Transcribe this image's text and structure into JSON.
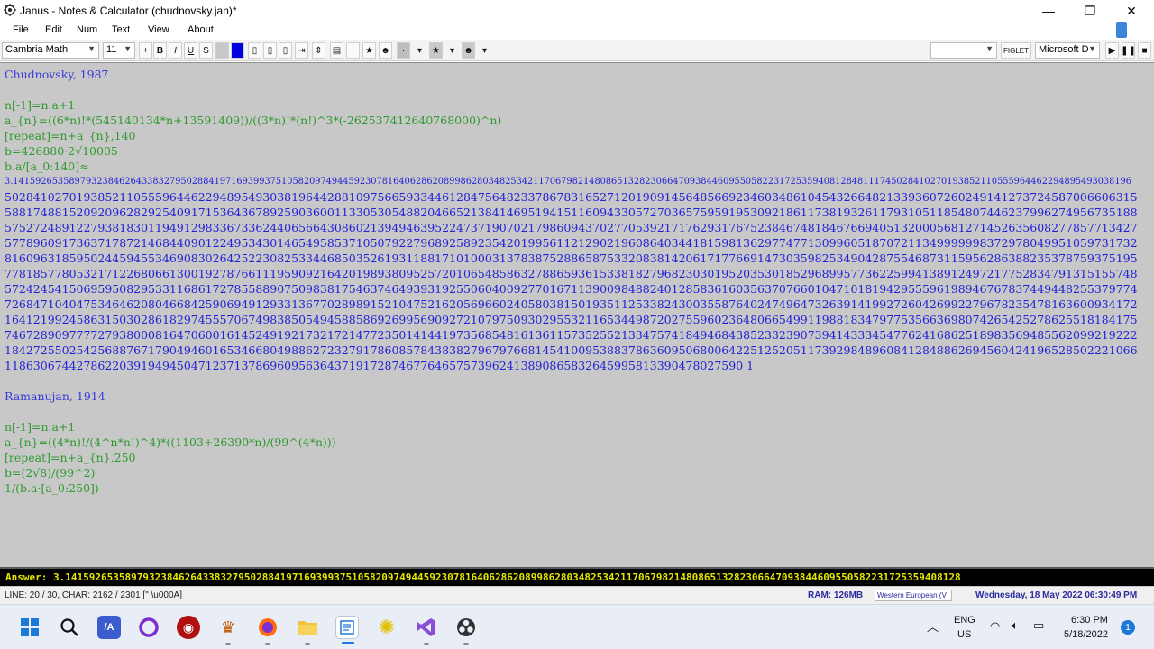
{
  "window": {
    "title": "Janus - Notes & Calculator (chudnovsky.jan)*",
    "icon": "gear-flower-icon",
    "minimize": "—",
    "maximize": "❐",
    "close": "✕"
  },
  "menu": [
    "File",
    "Edit",
    "Num",
    "Text",
    "View",
    "About"
  ],
  "toolbar": {
    "font": "Cambria Math",
    "size": "11",
    "plus": "+",
    "bold": "B",
    "italic": "I",
    "underline": "U",
    "strike": "S",
    "dot": "·",
    "right_combo": "",
    "figlet": "FIGLET",
    "figlet_font": "Microsoft D",
    "colors": {
      "blue_swatch": "#0000e0",
      "gray_swatch": "#c8c8c8"
    }
  },
  "editor": {
    "lines": [
      {
        "text": "Chudnovsky, 1987",
        "style": "heading"
      },
      {
        "text": "",
        "style": "heading"
      },
      {
        "text": "n[-1]=n.a+1",
        "style": "formula"
      },
      {
        "text": "a_{n}=((6*n)!*(545140134*n+13591409))/((3*n)!*(n!)^3*(-262537412640768000)^n)",
        "style": "formula"
      },
      {
        "text": "[repeat]=n+a_{n},140",
        "style": "formula"
      },
      {
        "text": "b=426880·2√10005",
        "style": "formula"
      },
      {
        "text": "b.a/[a_0:140]≈",
        "style": "formula"
      },
      {
        "text": "3.14159265358979323846264338327950288419716939937510582097494459230781640628620899862803482534211706798214808651328230664709384460955058223172535940812848111745028410270193852110555964462294895493038196",
        "style": "digits"
      },
      {
        "text": "50284102701938521105559644622948954930381964428810975665933446128475648233786783165271201909145648566923460348610454326648213393607260249141273724587006606315",
        "style": "digits"
      },
      {
        "text": "58817488152092096282925409171536436789259036001133053054882046652138414695194151160943305727036575959195309218611738193261179310511854807446237996274956735188",
        "style": "digits"
      },
      {
        "text": "57527248912279381830119491298336733624406566430860213949463952247371907021798609437027705392171762931767523846748184676694051320005681271452635608277857713427",
        "style": "digits"
      },
      {
        "text": "57789609173637178721468440901224953430146549585371050792279689258923542019956112129021960864034418159813629774771309960518707211349999998372978049951059731732",
        "style": "digits"
      },
      {
        "text": "81609631859502445945534690830264252230825334468503526193118817101000313783875288658753320838142061717766914730359825349042875546873115956286388235378759375195",
        "style": "digits"
      },
      {
        "text": "77818577805321712268066130019278766111959092164201989380952572010654858632788659361533818279682303019520353018529689957736225994138912497217752834791315155748",
        "style": "digits"
      },
      {
        "text": "57242454150695950829533116861727855889075098381754637464939319255060400927701671139009848824012858361603563707660104710181942955596198946767837449448255379774",
        "style": "digits"
      },
      {
        "text": "72684710404753464620804668425906949129331367702898915210475216205696602405803815019351125338243003558764024749647326391419927260426992279678235478163600934172",
        "style": "digits"
      },
      {
        "text": "16412199245863150302861829745557067498385054945885869269956909272107975093029553211653449872027559602364806654991198818347977535663698074265425278625518184175",
        "style": "digits"
      },
      {
        "text": "74672890977772793800081647060016145249192173217214772350141441973568548161361157352552133475741849468438523323907394143334547762416862518983569485562099219222",
        "style": "digits"
      },
      {
        "text": "18427255025425688767179049460165346680498862723279178608578438382796797668145410095388378636095068006422512520511739298489608412848862694560424196528502221066",
        "style": "digits"
      },
      {
        "text": "1186306744278622039194945047123713786960956364371917287467764657573962413890865832645995813390478027590 1",
        "style": "digits"
      },
      {
        "text": "",
        "style": "heading"
      },
      {
        "text": "Ramanujan, 1914",
        "style": "heading"
      },
      {
        "text": "",
        "style": "heading"
      },
      {
        "text": "n[-1]=n.a+1",
        "style": "formula"
      },
      {
        "text": "a_{n}=((4*n)!/(4^n*n!)^4)*((1103+26390*n)/(99^(4*n)))",
        "style": "formula"
      },
      {
        "text": "[repeat]=n+a_{n},250",
        "style": "formula"
      },
      {
        "text": "b=(2√8)/(99^2)",
        "style": "formula"
      },
      {
        "text": "1/(b.a·[a_0:250])",
        "style": "formula"
      }
    ]
  },
  "answer": {
    "label": "Answer:",
    "value": "3.141592653589793238462643383279502884197169399375105820974944592307816406286208998628034825342117067982148086513282306647093844609550582231725359408128"
  },
  "status": {
    "position": "LINE: 20 / 30, CHAR: 2162 / 2301 [\" \\u000A]",
    "ram": "RAM: 126MB",
    "encoding": "Western European (V",
    "datetime": "Wednesday, 18 May 2022 06:30:49 PM"
  },
  "taskbar": {
    "apps": [
      "windows-start-icon",
      "search-icon",
      "visual-studio-code-icon",
      "cortana-icon",
      "app-red-icon",
      "janus-eye-icon",
      "firefox-icon",
      "file-explorer-icon",
      "notepad-icon",
      "paint-icon",
      "visual-studio-icon",
      "obs-icon"
    ],
    "lang_top": "ENG",
    "lang_bottom": "US",
    "time": "6:30 PM",
    "date": "5/18/2022",
    "notifications": "1"
  }
}
